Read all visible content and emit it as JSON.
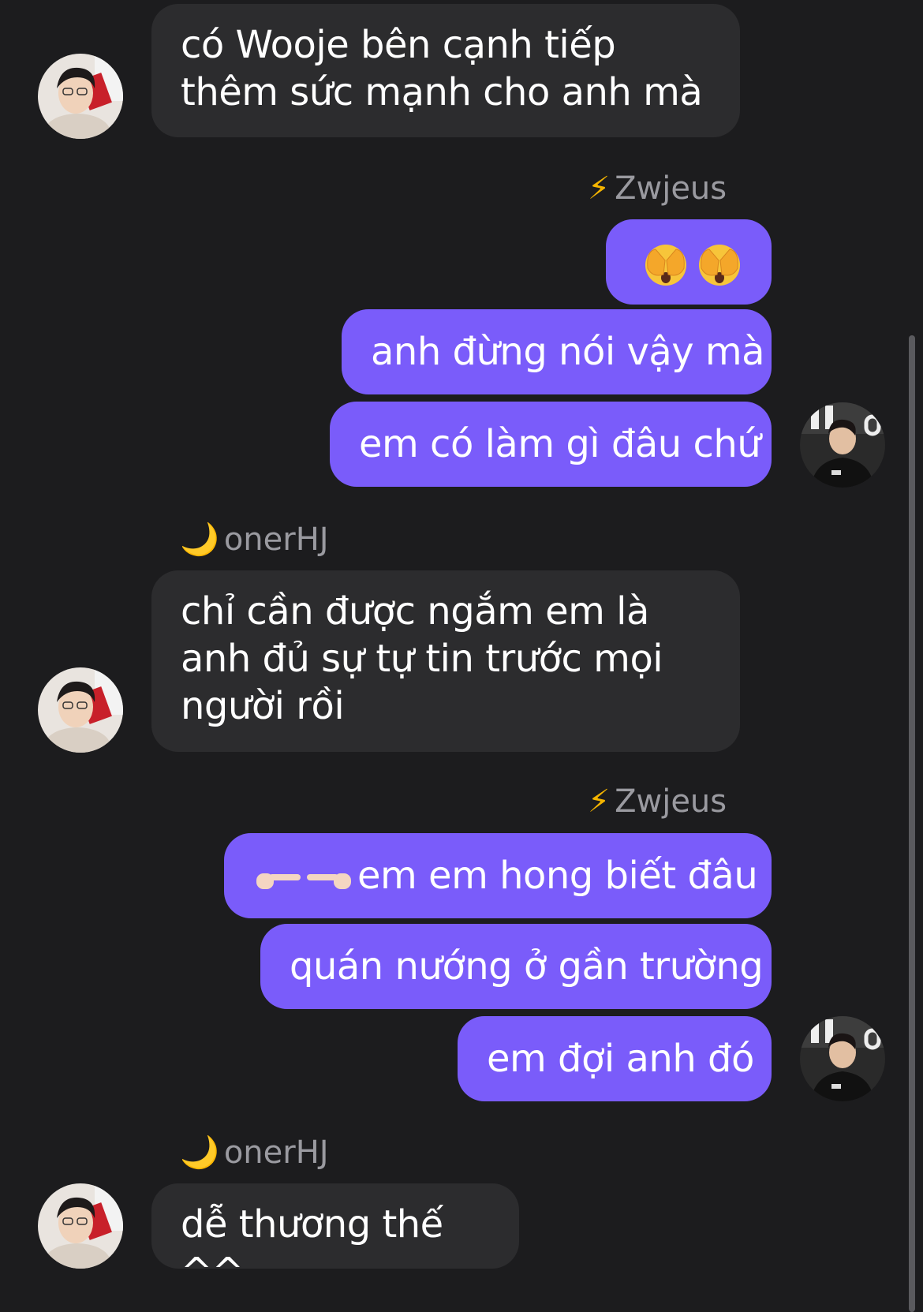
{
  "chat": {
    "messages": [
      {
        "id": "m1",
        "side": "in",
        "text": "có Wooje bên cạnh tiếp thêm sức mạnh cho anh mà"
      },
      {
        "id": "m2",
        "side": "out",
        "sender": "Zwjeus",
        "text": ""
      },
      {
        "id": "m3",
        "side": "out",
        "text": "anh đừng nói vậy mà"
      },
      {
        "id": "m4",
        "side": "out",
        "text": "em có làm gì đâu chứ"
      },
      {
        "id": "m5",
        "side": "in",
        "sender": "onerHJ",
        "text": "chỉ cần được ngắm em là anh đủ sự tự tin trước mọi người rồi"
      },
      {
        "id": "m6",
        "side": "out",
        "sender": "Zwjeus",
        "text": "em em hong biết đâu"
      },
      {
        "id": "m7",
        "side": "out",
        "text": "quán nướng ở gần trường"
      },
      {
        "id": "m8",
        "side": "out",
        "text": "em đợi anh đó"
      },
      {
        "id": "m9",
        "side": "in",
        "sender": "onerHJ",
        "text": "dễ thương thế ^^"
      }
    ],
    "names": {
      "zwjeus_1": "Zwjeus",
      "onerhj_1": "onerHJ",
      "zwjeus_2": "Zwjeus",
      "onerhj_2": "onerHJ"
    },
    "name_glyphs": {
      "bolt": "⚡",
      "moon": "🌙"
    },
    "icons": {
      "outgoing_sender_icon": "lightning-bolt-icon",
      "incoming_sender_icon": "crescent-moon-icon",
      "emoji_reaction": "face-with-hands-over-eyes-icon",
      "pointing_fingers": "fingers-pointing-icon"
    },
    "colors": {
      "background": "#1c1c1e",
      "incoming_bubble": "#2c2c2e",
      "outgoing_bubble": "#7a5cfa",
      "name_text": "#9a9aa0"
    }
  }
}
